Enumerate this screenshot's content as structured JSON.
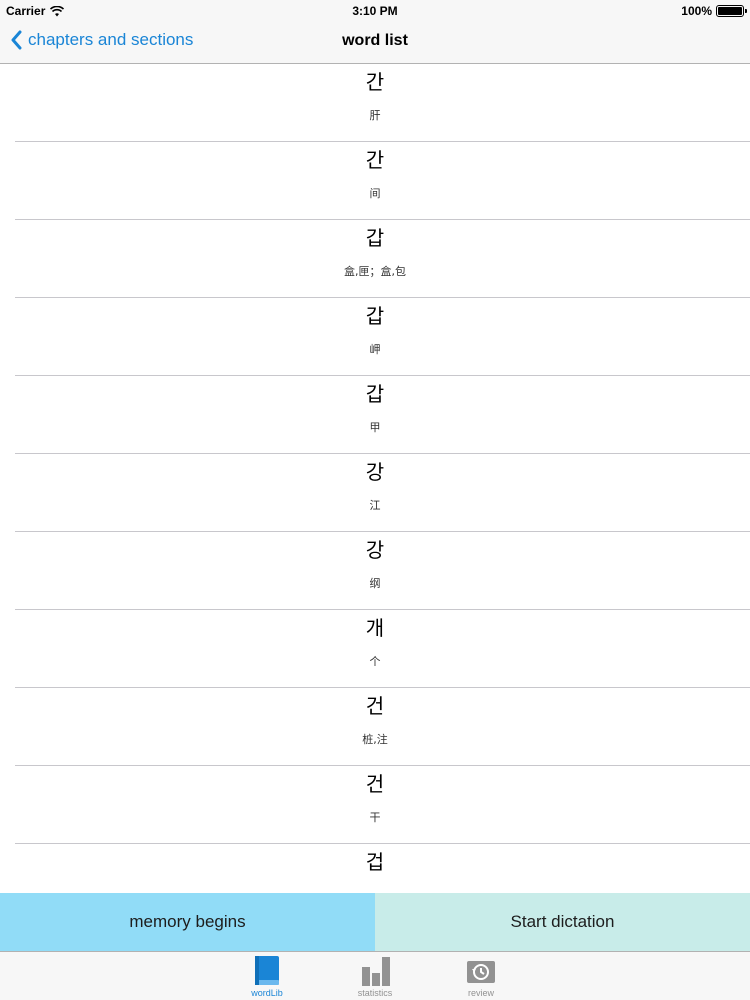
{
  "status_bar": {
    "carrier": "Carrier",
    "time": "3:10 PM",
    "battery": "100%"
  },
  "nav": {
    "back_label": "chapters and sections",
    "title": "word list"
  },
  "words": [
    {
      "korean": "간",
      "meaning": "肝"
    },
    {
      "korean": "간",
      "meaning": "间"
    },
    {
      "korean": "갑",
      "meaning": "盒,匣；盒,包"
    },
    {
      "korean": "갑",
      "meaning": "岬"
    },
    {
      "korean": "갑",
      "meaning": "甲"
    },
    {
      "korean": "강",
      "meaning": "江"
    },
    {
      "korean": "강",
      "meaning": "纲"
    },
    {
      "korean": "개",
      "meaning": "个"
    },
    {
      "korean": "건",
      "meaning": "桩,注"
    },
    {
      "korean": "건",
      "meaning": "干"
    },
    {
      "korean": "겁",
      "meaning": ""
    }
  ],
  "actions": {
    "memory_label": "memory begins",
    "dictation_label": "Start dictation"
  },
  "tabs": [
    {
      "label": "wordLib",
      "icon": "book-icon",
      "active": true
    },
    {
      "label": "statistics",
      "icon": "bar-chart-icon",
      "active": false
    },
    {
      "label": "review",
      "icon": "history-icon",
      "active": false
    }
  ],
  "colors": {
    "accent": "#1a85d6",
    "memory_button": "#91dcf7",
    "dictation_button": "#c8ece9",
    "tab_inactive": "#929292"
  }
}
